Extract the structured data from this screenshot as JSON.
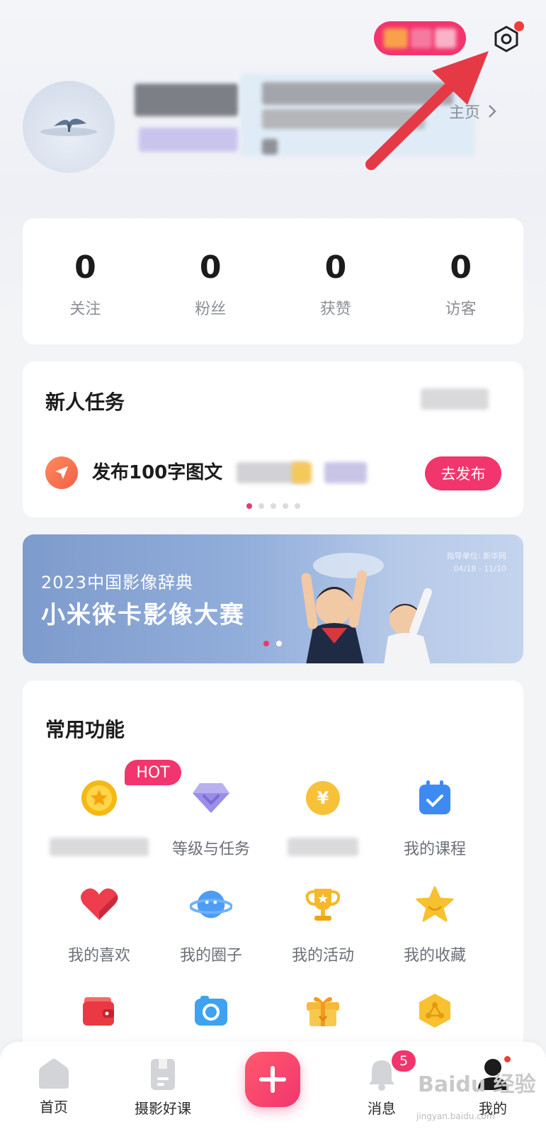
{
  "colors": {
    "accent": "#f2356d",
    "page_bg": "#f3f4f6",
    "card_bg": "#ffffff"
  },
  "header": {
    "settings_icon": "hexagon-settings-icon",
    "homepage_link": "主页",
    "annotation": "red-arrow-pointing-at-settings"
  },
  "stats": [
    {
      "value": "0",
      "label": "关注"
    },
    {
      "value": "0",
      "label": "粉丝"
    },
    {
      "value": "0",
      "label": "获赞"
    },
    {
      "value": "0",
      "label": "访客"
    }
  ],
  "task_card": {
    "title": "新人任务",
    "task_text": "发布100字图文",
    "publish_label": "去发布",
    "page_count": 5,
    "active_page": 0
  },
  "banner": {
    "subtitle": "2023中国影像辞典",
    "title": "小米徕卡影像大赛",
    "guide": "指导单位: 新华网",
    "dates": "04/18 - 11/10",
    "page_count": 2,
    "active_page": 0
  },
  "features": {
    "title": "常用功能",
    "hot_badge": "HOT",
    "items": [
      {
        "label": "",
        "icon": "gold-coin-star-icon"
      },
      {
        "label": "等级与任务",
        "icon": "diamond-level-icon"
      },
      {
        "label": "",
        "icon": "yuan-coin-icon"
      },
      {
        "label": "我的课程",
        "icon": "calendar-check-icon"
      },
      {
        "label": "我的喜欢",
        "icon": "heart-icon"
      },
      {
        "label": "我的圈子",
        "icon": "planet-icon"
      },
      {
        "label": "我的活动",
        "icon": "trophy-icon"
      },
      {
        "label": "我的收藏",
        "icon": "star-icon"
      },
      {
        "label": "",
        "icon": "wallet-icon"
      },
      {
        "label": "",
        "icon": "camera-icon"
      },
      {
        "label": "",
        "icon": "gift-icon"
      },
      {
        "label": "",
        "icon": "hexagon-badge-icon"
      }
    ]
  },
  "bottom_nav": {
    "home": "首页",
    "courses": "摄影好课",
    "messages": "消息",
    "messages_badge": "5",
    "mine": "我的"
  },
  "watermark": {
    "text": "Baidu 经验",
    "sub": "jingyan.baidu.com"
  }
}
